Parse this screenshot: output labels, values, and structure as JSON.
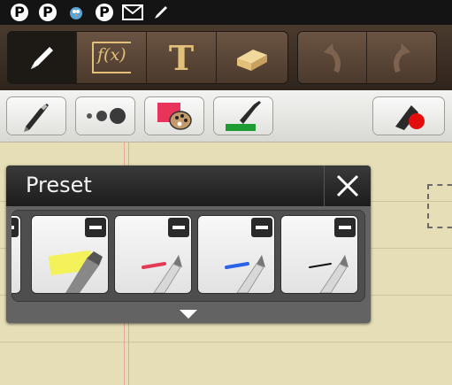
{
  "statusbar": {
    "icons": [
      "pinterest-icon",
      "pinterest-icon",
      "bird-icon",
      "pinterest-icon",
      "gmail-icon",
      "pen-icon"
    ]
  },
  "toolbar": {
    "tools": [
      "pen",
      "formula",
      "text",
      "eraser"
    ],
    "history": [
      "undo",
      "redo"
    ],
    "formula_label": "f(x)",
    "text_label": "T"
  },
  "subbar": {
    "items": [
      "pen-type",
      "pen-size",
      "pen-color",
      "color-stroke",
      "selection-tool"
    ]
  },
  "preset_panel": {
    "title": "Preset",
    "presets": [
      {
        "name": "highlighter",
        "color": "#f4f25a"
      },
      {
        "name": "red-pen",
        "color": "#e53a55"
      },
      {
        "name": "blue-pen",
        "color": "#2a63e8"
      },
      {
        "name": "black-pen",
        "color": "#111111"
      }
    ]
  },
  "colors": {
    "toolbar_bg": "#3a2e25",
    "paper": "#e6deb6",
    "panel": "#636363"
  }
}
